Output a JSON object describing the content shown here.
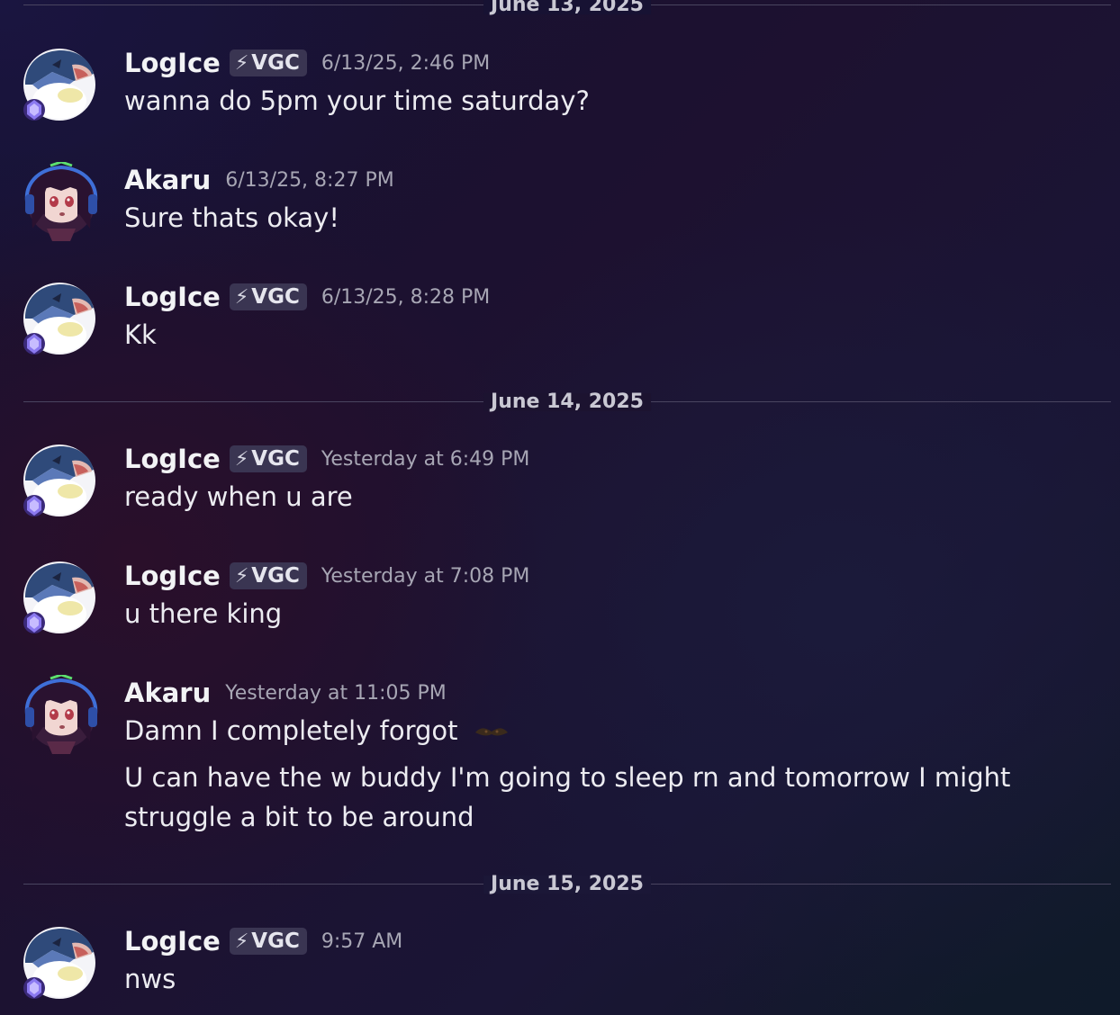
{
  "dividers": [
    "June 13, 2025",
    "June 14, 2025",
    "June 15, 2025"
  ],
  "users": {
    "logice": {
      "name": "LogIce",
      "tag": "VGC"
    },
    "akaru": {
      "name": "Akaru"
    }
  },
  "messages": [
    {
      "user": "LogIce",
      "tag": "VGC",
      "time": "6/13/25, 2:46 PM",
      "text": "wanna do 5pm your time saturday?"
    },
    {
      "user": "Akaru",
      "time": "6/13/25, 8:27 PM",
      "text": "Sure thats okay!"
    },
    {
      "user": "LogIce",
      "tag": "VGC",
      "time": "6/13/25, 8:28 PM",
      "text": "Kk"
    },
    {
      "user": "LogIce",
      "tag": "VGC",
      "time": "Yesterday at 6:49 PM",
      "text": "ready when u are"
    },
    {
      "user": "LogIce",
      "tag": "VGC",
      "time": "Yesterday at 7:08 PM",
      "text": "u there king"
    },
    {
      "user": "Akaru",
      "time": "Yesterday at 11:05 PM",
      "text": "Damn I completely forgot",
      "text2": "U can have the w buddy I'm going to sleep rn and tomorrow I might struggle a bit to be around"
    },
    {
      "user": "LogIce",
      "tag": "VGC",
      "time": "9:57 AM",
      "text": "nws"
    }
  ],
  "icons": {
    "tag_icon": "lightning-bolt-icon",
    "emoji": "custom-emoji-icon"
  }
}
